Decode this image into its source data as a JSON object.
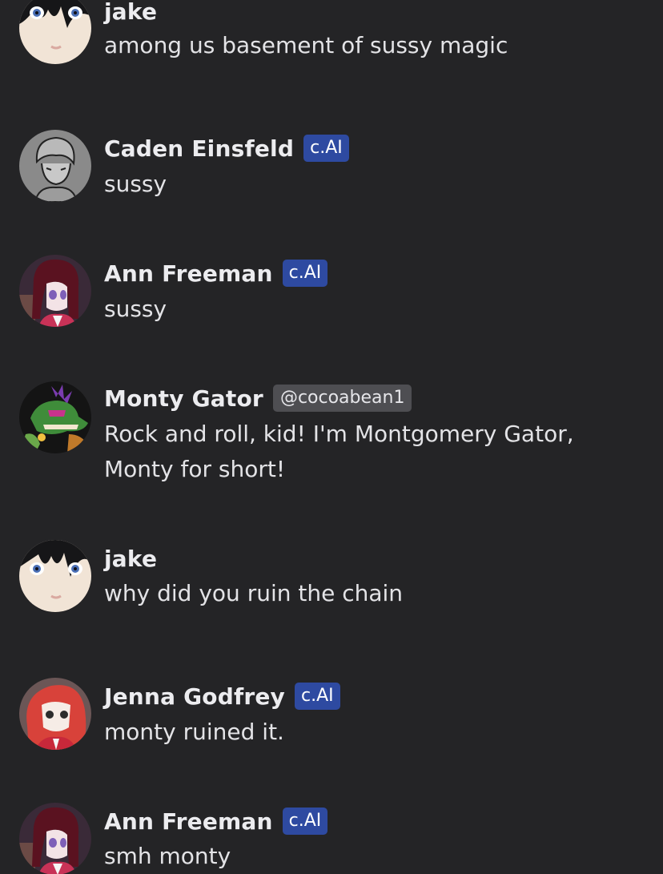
{
  "messages": [
    {
      "author": "jake",
      "badge": "",
      "text": "among us basement of sussy magic",
      "avatar_icon": "jake-avatar"
    },
    {
      "author": "Caden Einsfeld",
      "badge": "c.AI",
      "text": "sussy",
      "avatar_icon": "caden-avatar"
    },
    {
      "author": "Ann Freeman",
      "badge": "c.AI",
      "text": "sussy",
      "avatar_icon": "ann-avatar"
    },
    {
      "author": "Monty Gator",
      "badge": "@cocoabean1",
      "text": "Rock and roll, kid! I'm Montgomery Gator, Monty for short!",
      "avatar_icon": "monty-avatar"
    },
    {
      "author": "jake",
      "badge": "",
      "text": "why did you ruin the chain",
      "avatar_icon": "jake-avatar"
    },
    {
      "author": "Jenna Godfrey",
      "badge": "c.AI",
      "text": "monty ruined it.",
      "avatar_icon": "jenna-avatar"
    },
    {
      "author": "Ann Freeman",
      "badge": "c.AI",
      "text": "smh monty",
      "avatar_icon": "ann-avatar"
    }
  ],
  "colors": {
    "background": "#242426",
    "ai_badge": "#2e4aa1",
    "handle_badge": "#4e4e52"
  }
}
